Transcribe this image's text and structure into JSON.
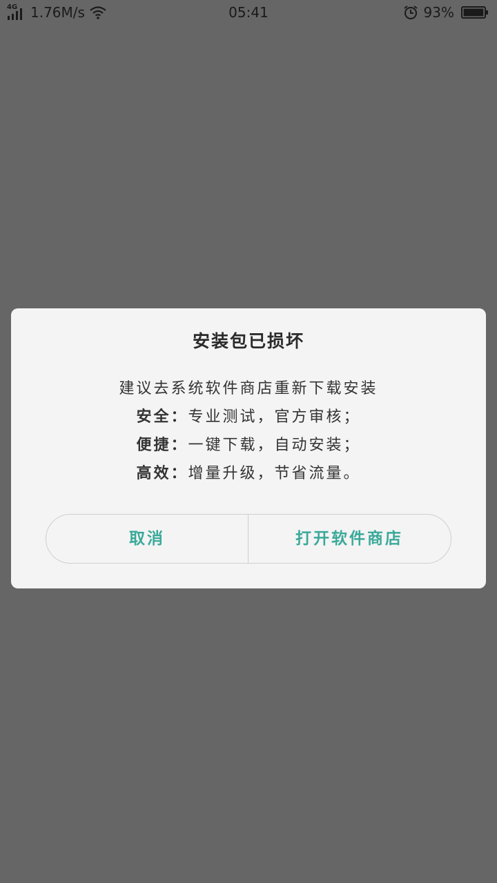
{
  "status_bar": {
    "network_type": "4G",
    "speed": "1.76M/s",
    "time": "05:41",
    "battery_percent": "93%",
    "battery_level": 0.93,
    "icons": [
      "signal-icon",
      "wifi-icon",
      "alarm-icon",
      "battery-icon"
    ]
  },
  "dialog": {
    "title": "安装包已损坏",
    "message": "建议去系统软件商店重新下载安装",
    "features": [
      {
        "key": "安全：",
        "text": "专业测试，官方审核；"
      },
      {
        "key": "便捷：",
        "text": "一键下载，自动安装；"
      },
      {
        "key": "高效：",
        "text": "增量升级，节省流量。"
      }
    ],
    "cancel_label": "取消",
    "open_store_label": "打开软件商店"
  },
  "colors": {
    "overlay": "#666666",
    "dialog_bg": "#f4f4f4",
    "accent": "#3aa99a",
    "text": "#333333"
  }
}
